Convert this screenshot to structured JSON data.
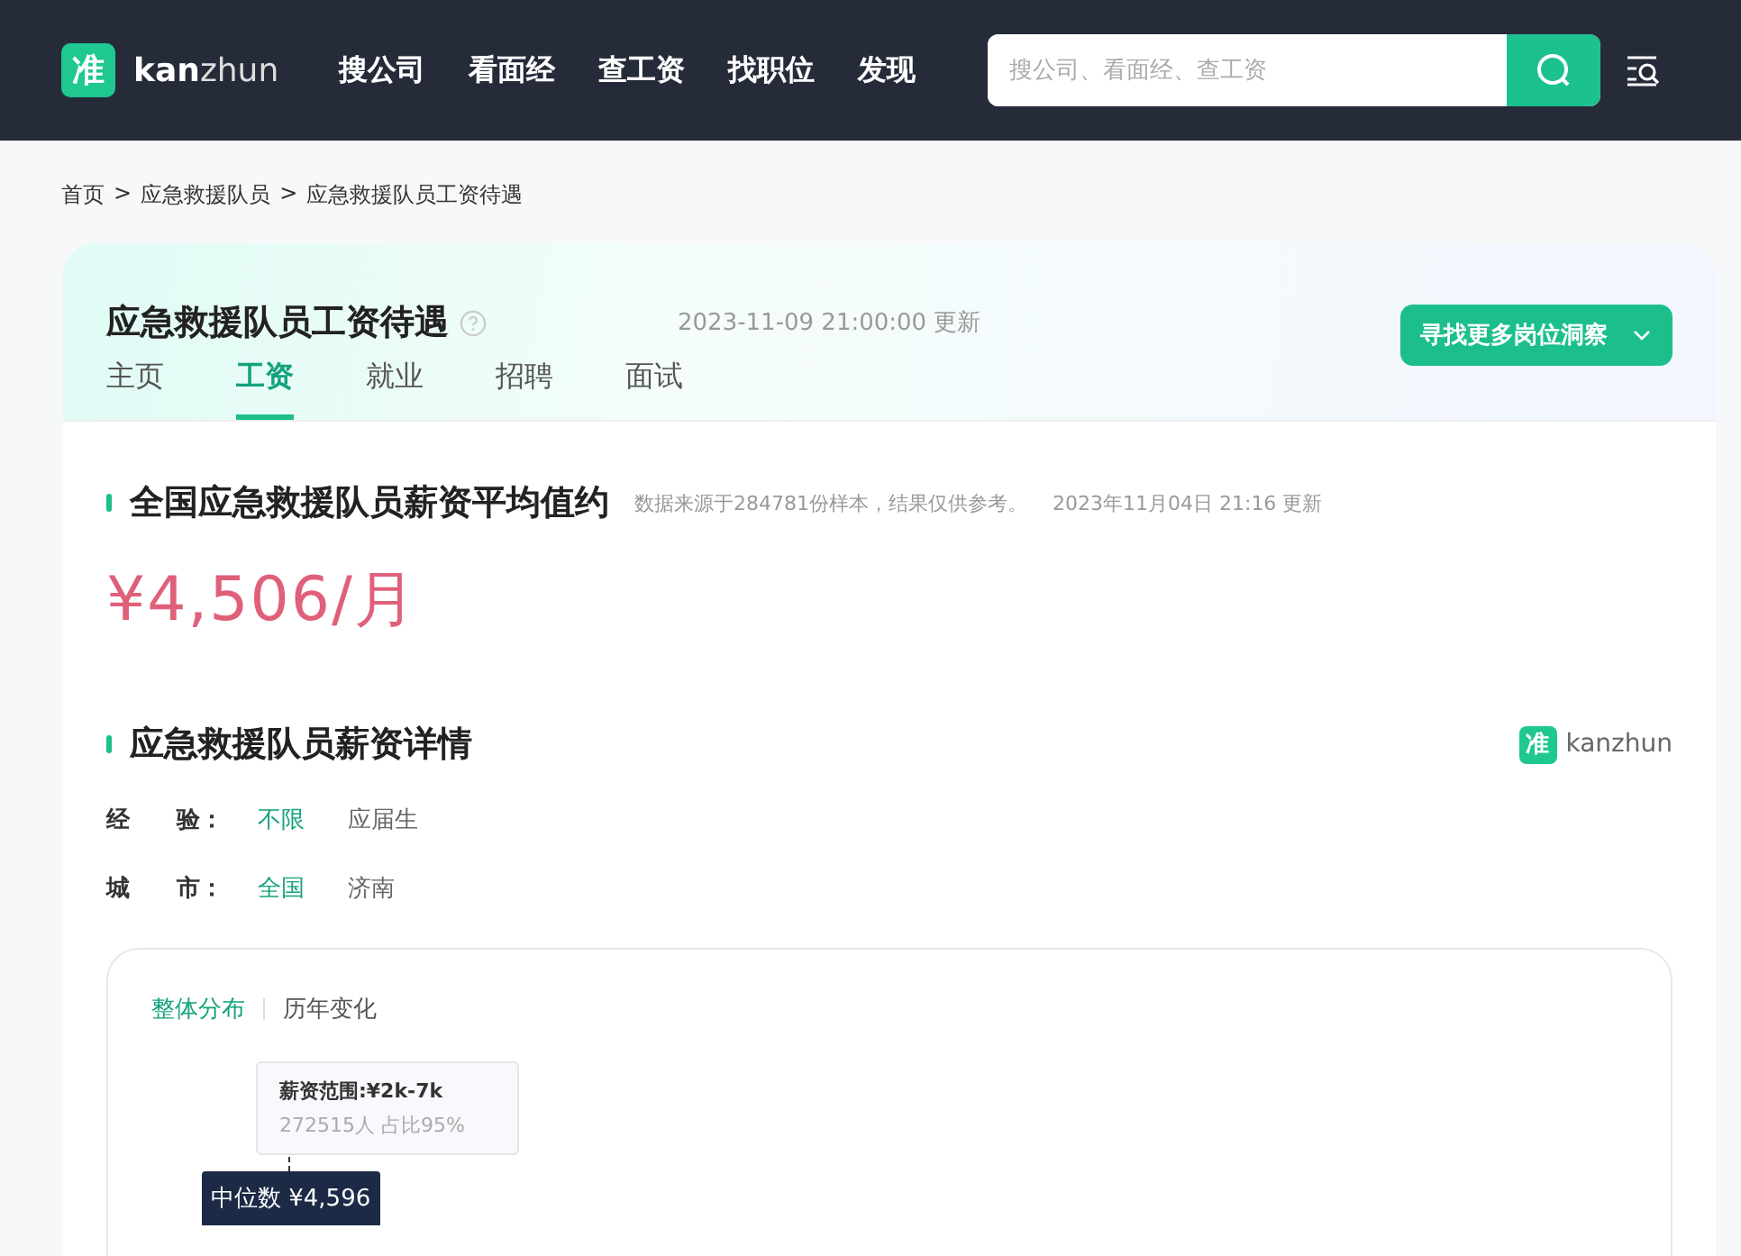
{
  "header": {
    "logo_mark": "准",
    "logo_text_bold": "kan",
    "logo_text": "zhun",
    "nav": [
      {
        "label": "搜公司"
      },
      {
        "label": "看面经"
      },
      {
        "label": "查工资"
      },
      {
        "label": "找职位"
      },
      {
        "label": "发现"
      }
    ],
    "search": {
      "placeholder": "搜公司、看面经、查工资"
    }
  },
  "breadcrumb": [
    "首页",
    "应急救援队员",
    "应急救援队员工资待遇"
  ],
  "breadcrumb_separator": ">",
  "title": "应急救援队员工资待遇",
  "updated": "2023-11-09 21:00:00 更新",
  "insight_button": "寻找更多岗位洞察",
  "tabs": [
    {
      "label": "主页",
      "selected": false
    },
    {
      "label": "工资",
      "selected": true
    },
    {
      "label": "就业",
      "selected": false
    },
    {
      "label": "招聘",
      "selected": false
    },
    {
      "label": "面试",
      "selected": false
    }
  ],
  "average": {
    "heading": "全国应急救援队员薪资平均值约",
    "note": "数据来源于284781份样本，结果仅供参考。",
    "updated": "2023年11月04日 21:16 更新",
    "value": "¥4,506/月"
  },
  "details": {
    "heading": "应急救援队员薪资详情",
    "brand_mark": "准",
    "brand_text": "kanzhun",
    "filters": [
      {
        "label": "经　　验：",
        "options": [
          {
            "label": "不限",
            "selected": true
          },
          {
            "label": "应届生",
            "selected": false
          }
        ]
      },
      {
        "label": "城　　市：",
        "options": [
          {
            "label": "全国",
            "selected": true
          },
          {
            "label": "济南",
            "selected": false
          }
        ]
      }
    ],
    "chart_tabs": [
      {
        "label": "整体分布",
        "selected": true
      },
      {
        "label": "历年变化",
        "selected": false
      }
    ],
    "tooltip": {
      "title": "薪资范围:¥2k-7k",
      "body": "272515人  占比95%"
    },
    "median": "中位数 ¥4,596"
  }
}
